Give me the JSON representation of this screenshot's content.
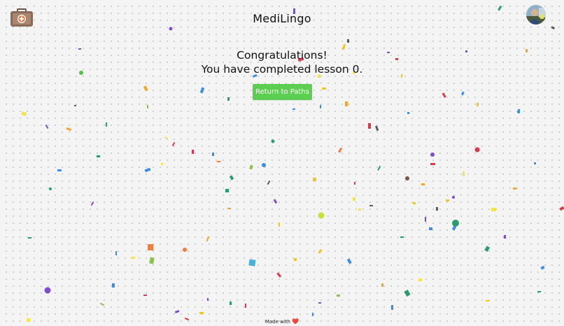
{
  "app": {
    "title": "MediLingo"
  },
  "header": {
    "logo_icon": "medical-kit-icon",
    "avatar_icon": "user-avatar"
  },
  "completion": {
    "heading": "Congratulations!",
    "message": "You have completed lesson 0."
  },
  "actions": {
    "return_label": "Return to Paths"
  },
  "footer": {
    "made_with": "Made with",
    "heart": "❤️"
  },
  "colors": {
    "accent_green": "#5ccf52",
    "logo_brown": "#8a6a58",
    "logo_orange": "#ec7a4a"
  }
}
